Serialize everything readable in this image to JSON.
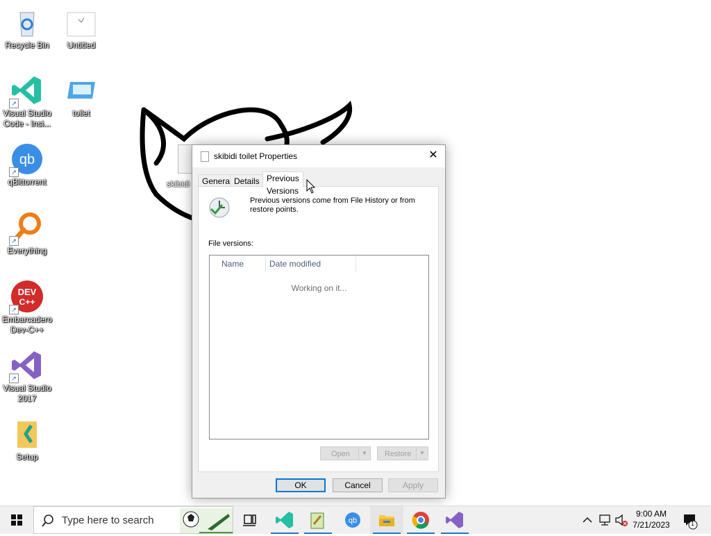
{
  "desktop": {
    "icons": [
      {
        "label": "Recycle Bin"
      },
      {
        "label": "Untitled"
      },
      {
        "label": "Visual Studio Code - Insi..."
      },
      {
        "label": "toilet"
      },
      {
        "label": "qBittorrent"
      },
      {
        "label": "Everything"
      },
      {
        "label": "Embarcadero Dev-C++"
      },
      {
        "label": "Visual Studio 2017"
      },
      {
        "label": "Setup"
      }
    ],
    "background_file_label": "skibidi"
  },
  "dialog": {
    "title": "skibidi toilet Properties",
    "tabs": [
      "General",
      "Details",
      "Previous Versions"
    ],
    "active_tab": "Previous Versions",
    "info_text": "Previous versions come from File History or from restore points.",
    "file_versions_label": "File versions:",
    "columns": [
      "Name",
      "Date modified"
    ],
    "status": "Working on it...",
    "open_label": "Open",
    "restore_label": "Restore",
    "ok_label": "OK",
    "cancel_label": "Cancel",
    "apply_label": "Apply"
  },
  "taskbar": {
    "search_placeholder": "Type here to search",
    "time": "9:00 AM",
    "date": "7/21/2023",
    "notification_count": "1",
    "apps": [
      "task-view",
      "vscode-insiders",
      "notepad-plus",
      "qbittorrent",
      "file-explorer",
      "chrome",
      "visual-studio"
    ]
  },
  "colors": {
    "accent": "#0078d7",
    "taskbar": "#f0f0f0"
  }
}
